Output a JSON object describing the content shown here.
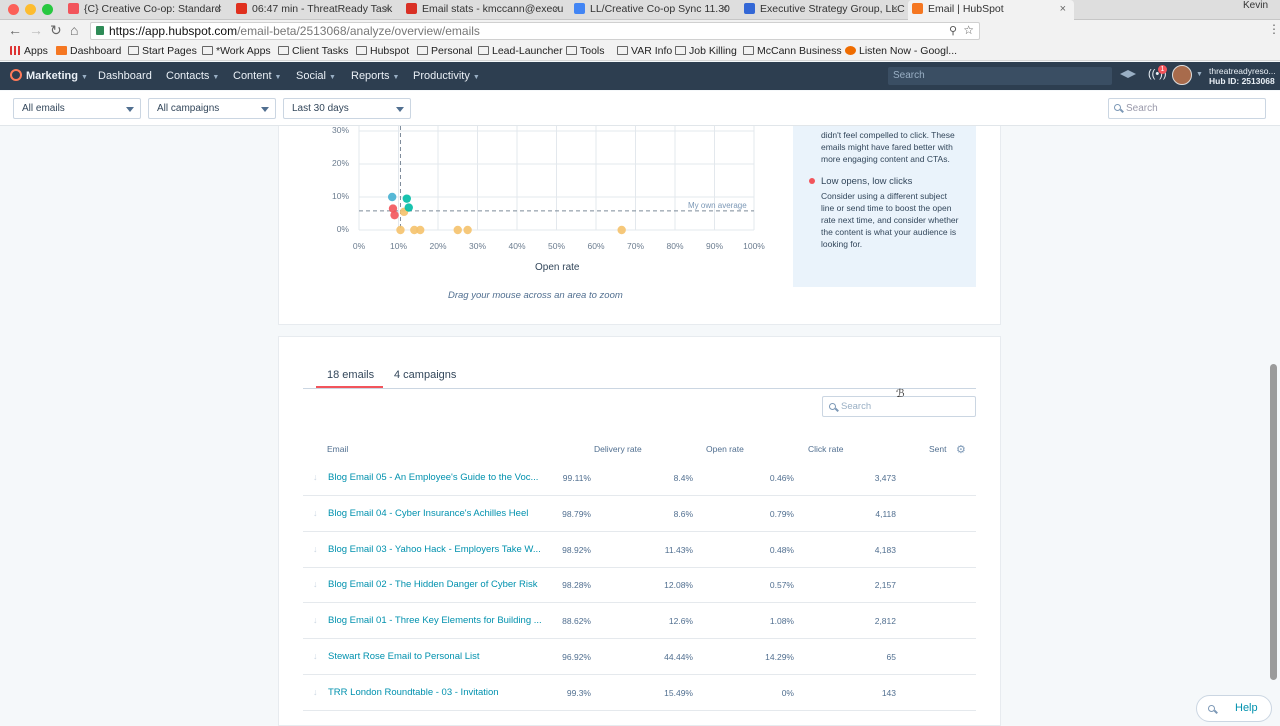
{
  "browser": {
    "tabs": [
      {
        "title": "{C} Creative Co-op: Standard",
        "icon": "hubspot-icon",
        "color": "#f2545b"
      },
      {
        "title": "06:47 min - ThreatReady Task",
        "icon": "timer-icon",
        "color": "#e0301e"
      },
      {
        "title": "Email stats - kmccann@execu",
        "icon": "gmail-icon",
        "color": "#d93025"
      },
      {
        "title": "LL/Creative Co-op Sync 11.30",
        "icon": "docs-icon",
        "color": "#4285f4"
      },
      {
        "title": "Executive Strategy Group, LLC",
        "icon": "calendar-icon",
        "color": "#3367d6"
      },
      {
        "title": "Email | HubSpot",
        "icon": "hubspot-icon",
        "color": "#f57722"
      }
    ],
    "profile_name": "Kevin",
    "url_host": "https://app.hubspot.com",
    "url_path": "/email-beta/2513068/analyze/overview/emails",
    "bookmarks": [
      "Apps",
      "Dashboard",
      "Start Pages",
      "*Work Apps",
      "Client Tasks",
      "Hubspot",
      "Personal",
      "Lead-Launcher",
      "Tools",
      "VAR Info",
      "Job Killing",
      "McCann Business",
      "Listen Now - Googl..."
    ]
  },
  "hubspot_nav": {
    "brand": "Marketing",
    "items": [
      "Dashboard",
      "Contacts",
      "Content",
      "Social",
      "Reports",
      "Productivity"
    ],
    "search_placeholder": "Search",
    "notification_count": "1",
    "account_name": "threatreadyreso...",
    "hub_id": "Hub ID: 2513068"
  },
  "filters": {
    "emails": "All emails",
    "campaigns": "All campaigns",
    "date_range": "Last 30 days",
    "search_placeholder": "Search"
  },
  "chart_data": {
    "type": "scatter",
    "xlabel": "Open rate",
    "ylabel": "",
    "x_ticks": [
      "0%",
      "10%",
      "20%",
      "30%",
      "40%",
      "50%",
      "60%",
      "70%",
      "80%",
      "90%",
      "100%"
    ],
    "y_ticks": [
      "0%",
      "10%",
      "20%",
      "30%"
    ],
    "xlim": [
      0,
      100
    ],
    "ylim": [
      0,
      30
    ],
    "average_label": "My own average",
    "average_x": 10.5,
    "average_y": 5.8,
    "points": [
      {
        "x": 8.4,
        "y": 10,
        "color": "#45b0d2"
      },
      {
        "x": 8.6,
        "y": 6.5,
        "color": "#f2545b"
      },
      {
        "x": 9.0,
        "y": 4.5,
        "color": "#f2545b"
      },
      {
        "x": 11.4,
        "y": 5.5,
        "color": "#f5c26b"
      },
      {
        "x": 12.1,
        "y": 9.5,
        "color": "#00bda5"
      },
      {
        "x": 12.6,
        "y": 6.8,
        "color": "#00bda5"
      },
      {
        "x": 10.5,
        "y": 0,
        "color": "#f5c26b"
      },
      {
        "x": 14.0,
        "y": 0,
        "color": "#f5c26b"
      },
      {
        "x": 15.5,
        "y": 0,
        "color": "#f5c26b"
      },
      {
        "x": 25.0,
        "y": 0,
        "color": "#f5c26b"
      },
      {
        "x": 27.5,
        "y": 0,
        "color": "#f5c26b"
      },
      {
        "x": 66.5,
        "y": 0,
        "color": "#f5c26b"
      }
    ],
    "hint": "Drag your mouse across an area to zoom"
  },
  "legend": {
    "partial_text": "didn't feel compelled to click. These emails might have fared better with more engaging content and CTAs.",
    "low_opens_title": "Low opens, low clicks",
    "low_opens_desc": "Consider using a different subject line or send time to boost the open rate next time, and consider whether the content is what your audience is looking for.",
    "low_opens_color": "#f2545b"
  },
  "table": {
    "tab_emails": "18 emails",
    "tab_campaigns": "4 campaigns",
    "search_placeholder": "Search",
    "headers": {
      "email": "Email",
      "delivery": "Delivery rate",
      "open": "Open rate",
      "click": "Click rate",
      "sent": "Sent"
    },
    "rows": [
      {
        "name": "Blog Email 05 - An Employee's Guide to the Voc...",
        "delivery": "99.11%",
        "open": "8.4%",
        "click": "0.46%",
        "sent": "3,473"
      },
      {
        "name": "Blog Email 04 - Cyber Insurance's Achilles Heel",
        "delivery": "98.79%",
        "open": "8.6%",
        "click": "0.79%",
        "sent": "4,118"
      },
      {
        "name": "Blog Email 03 - Yahoo Hack - Employers Take W...",
        "delivery": "98.92%",
        "open": "11.43%",
        "click": "0.48%",
        "sent": "4,183"
      },
      {
        "name": "Blog Email 02 - The Hidden Danger of Cyber Risk",
        "delivery": "98.28%",
        "open": "12.08%",
        "click": "0.57%",
        "sent": "2,157"
      },
      {
        "name": "Blog Email 01 - Three Key Elements for Building ...",
        "delivery": "88.62%",
        "open": "12.6%",
        "click": "1.08%",
        "sent": "2,812"
      },
      {
        "name": "Stewart Rose Email to Personal List",
        "delivery": "96.92%",
        "open": "44.44%",
        "click": "14.29%",
        "sent": "65"
      },
      {
        "name": "TRR London Roundtable - 03 - Invitation",
        "delivery": "99.3%",
        "open": "15.49%",
        "click": "0%",
        "sent": "143"
      }
    ]
  },
  "help_label": "Help"
}
